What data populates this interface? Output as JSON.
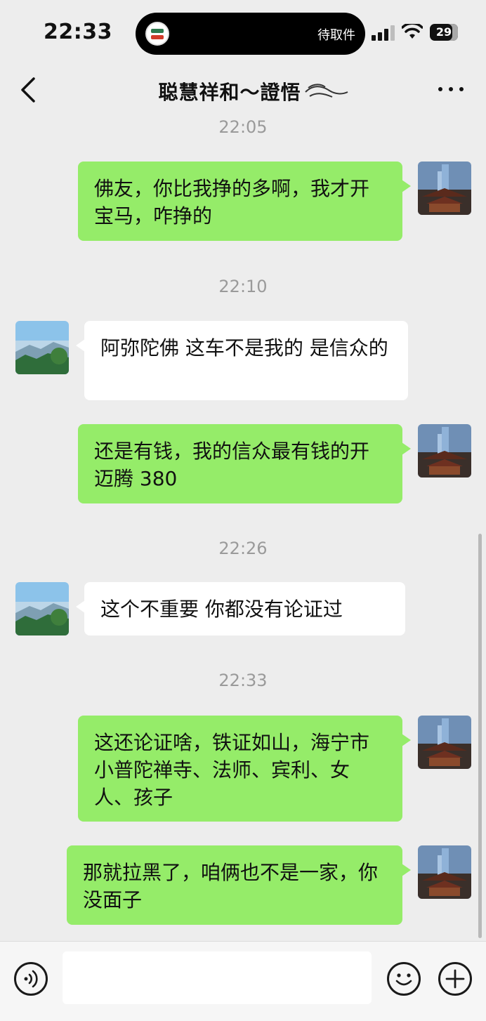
{
  "status_bar": {
    "time": "22:33",
    "island_text": "待取件",
    "battery": "29"
  },
  "nav": {
    "title": "聪慧祥和～證悟"
  },
  "timestamps": [
    "22:05",
    "22:10",
    "22:26",
    "22:33"
  ],
  "messages": [
    {
      "side": "mine",
      "text": "佛友，你比我挣的多啊，我才开宝马，咋挣的"
    },
    {
      "side": "theirs",
      "text": "阿弥陀佛  这车不是我的  是信众的"
    },
    {
      "side": "mine",
      "text": "还是有钱，我的信众最有钱的开迈腾 380"
    },
    {
      "side": "theirs",
      "text": "这个不重要  你都没有论证过"
    },
    {
      "side": "mine",
      "text": "这还论证啥，铁证如山，海宁市小普陀禅寺、法师、宾利、女人、孩子"
    },
    {
      "side": "mine",
      "text": "那就拉黑了，咱俩也不是一家，你没面子"
    }
  ],
  "input": {
    "value": ""
  },
  "colors": {
    "my_bubble": "#95ec69",
    "their_bubble": "#ffffff",
    "background": "#ededed"
  }
}
